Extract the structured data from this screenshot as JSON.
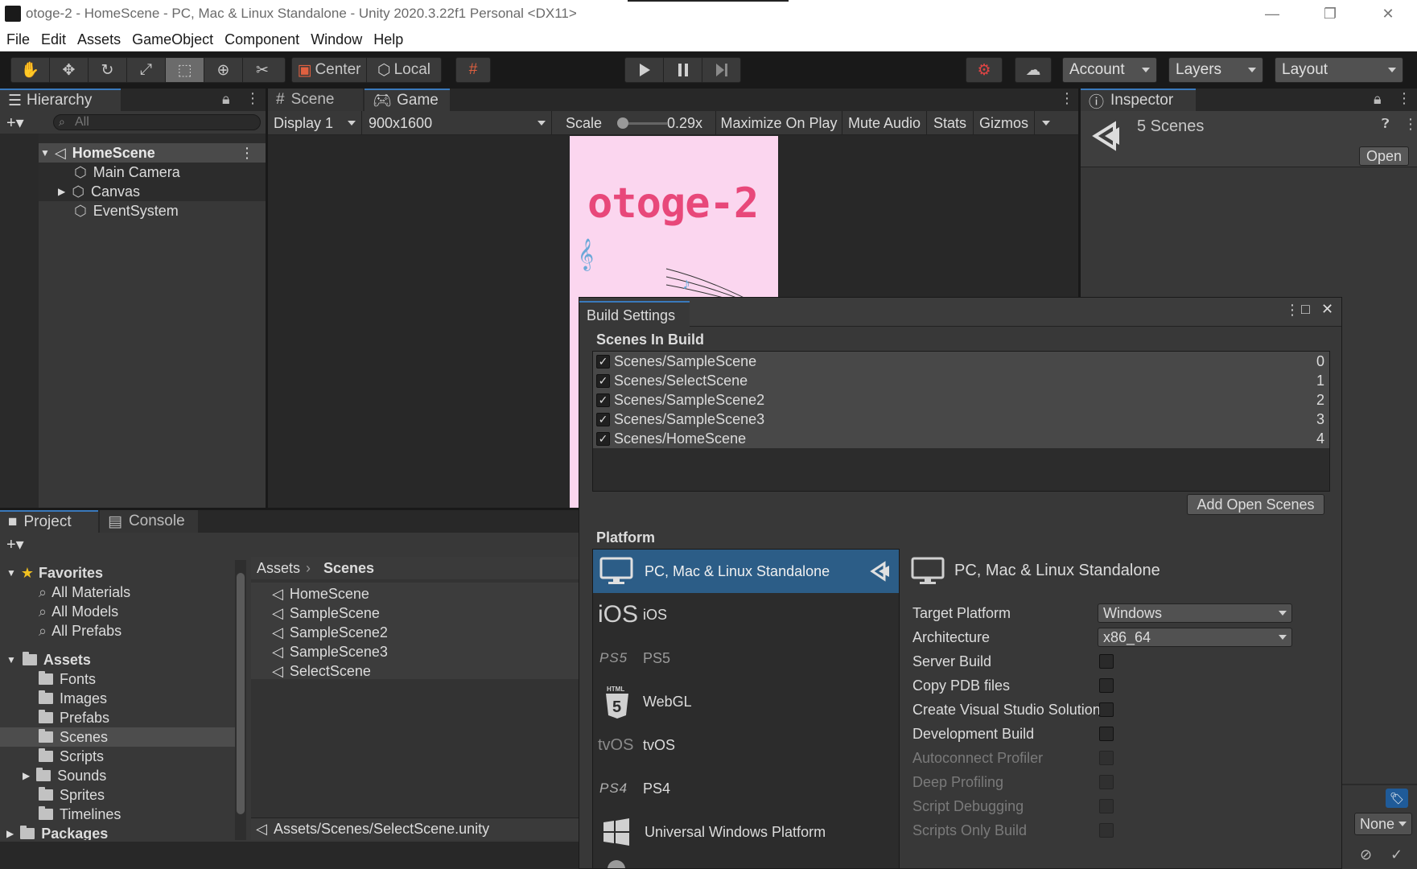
{
  "window": {
    "title": "otoge-2 - HomeScene - PC, Mac & Linux Standalone - Unity 2020.3.22f1 Personal <DX11>",
    "minimize": "—",
    "restore": "❐",
    "close": "✕"
  },
  "menu": [
    "File",
    "Edit",
    "Assets",
    "GameObject",
    "Component",
    "Window",
    "Help"
  ],
  "toolbar": {
    "pivot_center": "Center",
    "pivot_local": "Local",
    "account": "Account",
    "layers": "Layers",
    "layout": "Layout"
  },
  "hierarchy": {
    "tab": "Hierarchy",
    "search_placeholder": "All",
    "scene": "HomeScene",
    "items": [
      "Main Camera",
      "Canvas",
      "EventSystem"
    ]
  },
  "scene_tabs": {
    "scene": "Scene",
    "game": "Game"
  },
  "game_toolbar": {
    "display": "Display 1",
    "resolution": "900x1600",
    "scale_label": "Scale",
    "scale_value": "0.29x",
    "maximize": "Maximize On Play",
    "mute": "Mute Audio",
    "stats": "Stats",
    "gizmos": "Gizmos"
  },
  "game_view": {
    "logo": "otoge-2"
  },
  "inspector": {
    "tab": "Inspector",
    "title": "5 Scenes",
    "open": "Open",
    "none_dropdown": "None"
  },
  "project": {
    "tab_project": "Project",
    "tab_console": "Console",
    "favorites_label": "Favorites",
    "favorites": [
      "All Materials",
      "All Models",
      "All Prefabs"
    ],
    "assets_label": "Assets",
    "folders": [
      "Fonts",
      "Images",
      "Prefabs",
      "Scenes",
      "Scripts",
      "Sounds",
      "Sprites",
      "Timelines"
    ],
    "packages_label": "Packages",
    "breadcrumb_root": "Assets",
    "breadcrumb_current": "Scenes",
    "files": [
      "HomeScene",
      "SampleScene",
      "SampleScene2",
      "SampleScene3",
      "SelectScene"
    ],
    "status_path": "Assets/Scenes/SelectScene.unity"
  },
  "build_settings": {
    "title": "Build Settings",
    "scenes_header": "Scenes In Build",
    "scenes": [
      {
        "name": "Scenes/SampleScene",
        "index": "0"
      },
      {
        "name": "Scenes/SelectScene",
        "index": "1"
      },
      {
        "name": "Scenes/SampleScene2",
        "index": "2"
      },
      {
        "name": "Scenes/SampleScene3",
        "index": "3"
      },
      {
        "name": "Scenes/HomeScene",
        "index": "4"
      }
    ],
    "add_open_scenes": "Add Open Scenes",
    "platform_header": "Platform",
    "platforms": [
      {
        "name": "PC, Mac & Linux Standalone",
        "icon": "monitor-icon",
        "selected": true
      },
      {
        "name": "iOS",
        "icon": "ios-icon",
        "selected": false
      },
      {
        "name": "PS5",
        "icon": "ps5-icon",
        "selected": false
      },
      {
        "name": "WebGL",
        "icon": "html5-icon",
        "selected": false
      },
      {
        "name": "tvOS",
        "icon": "tvos-icon",
        "selected": false
      },
      {
        "name": "PS4",
        "icon": "ps4-icon",
        "selected": false
      },
      {
        "name": "Universal Windows Platform",
        "icon": "windows-icon",
        "selected": false
      }
    ],
    "platform_icon_text": {
      "ios": "iOS",
      "ps5": "PS5",
      "html": "HTML",
      "tvos": "tvOS",
      "ps4": "PS4"
    },
    "detail_title": "PC, Mac & Linux Standalone",
    "target_platform_label": "Target Platform",
    "target_platform_value": "Windows",
    "architecture_label": "Architecture",
    "architecture_value": "x86_64",
    "options": [
      {
        "label": "Server Build",
        "enabled": true
      },
      {
        "label": "Copy PDB files",
        "enabled": true
      },
      {
        "label": "Create Visual Studio Solution",
        "enabled": true
      },
      {
        "label": "Development Build",
        "enabled": true
      },
      {
        "label": "Autoconnect Profiler",
        "enabled": false
      },
      {
        "label": "Deep Profiling",
        "enabled": false
      },
      {
        "label": "Script Debugging",
        "enabled": false
      },
      {
        "label": "Scripts Only Build",
        "enabled": false
      }
    ]
  },
  "colors": {
    "accent_blue": "#2c5d87",
    "panel_bg": "#383838",
    "dark_bg": "#282828",
    "game_pink": "#fbd6ef",
    "logo_pink": "#e8487a"
  }
}
